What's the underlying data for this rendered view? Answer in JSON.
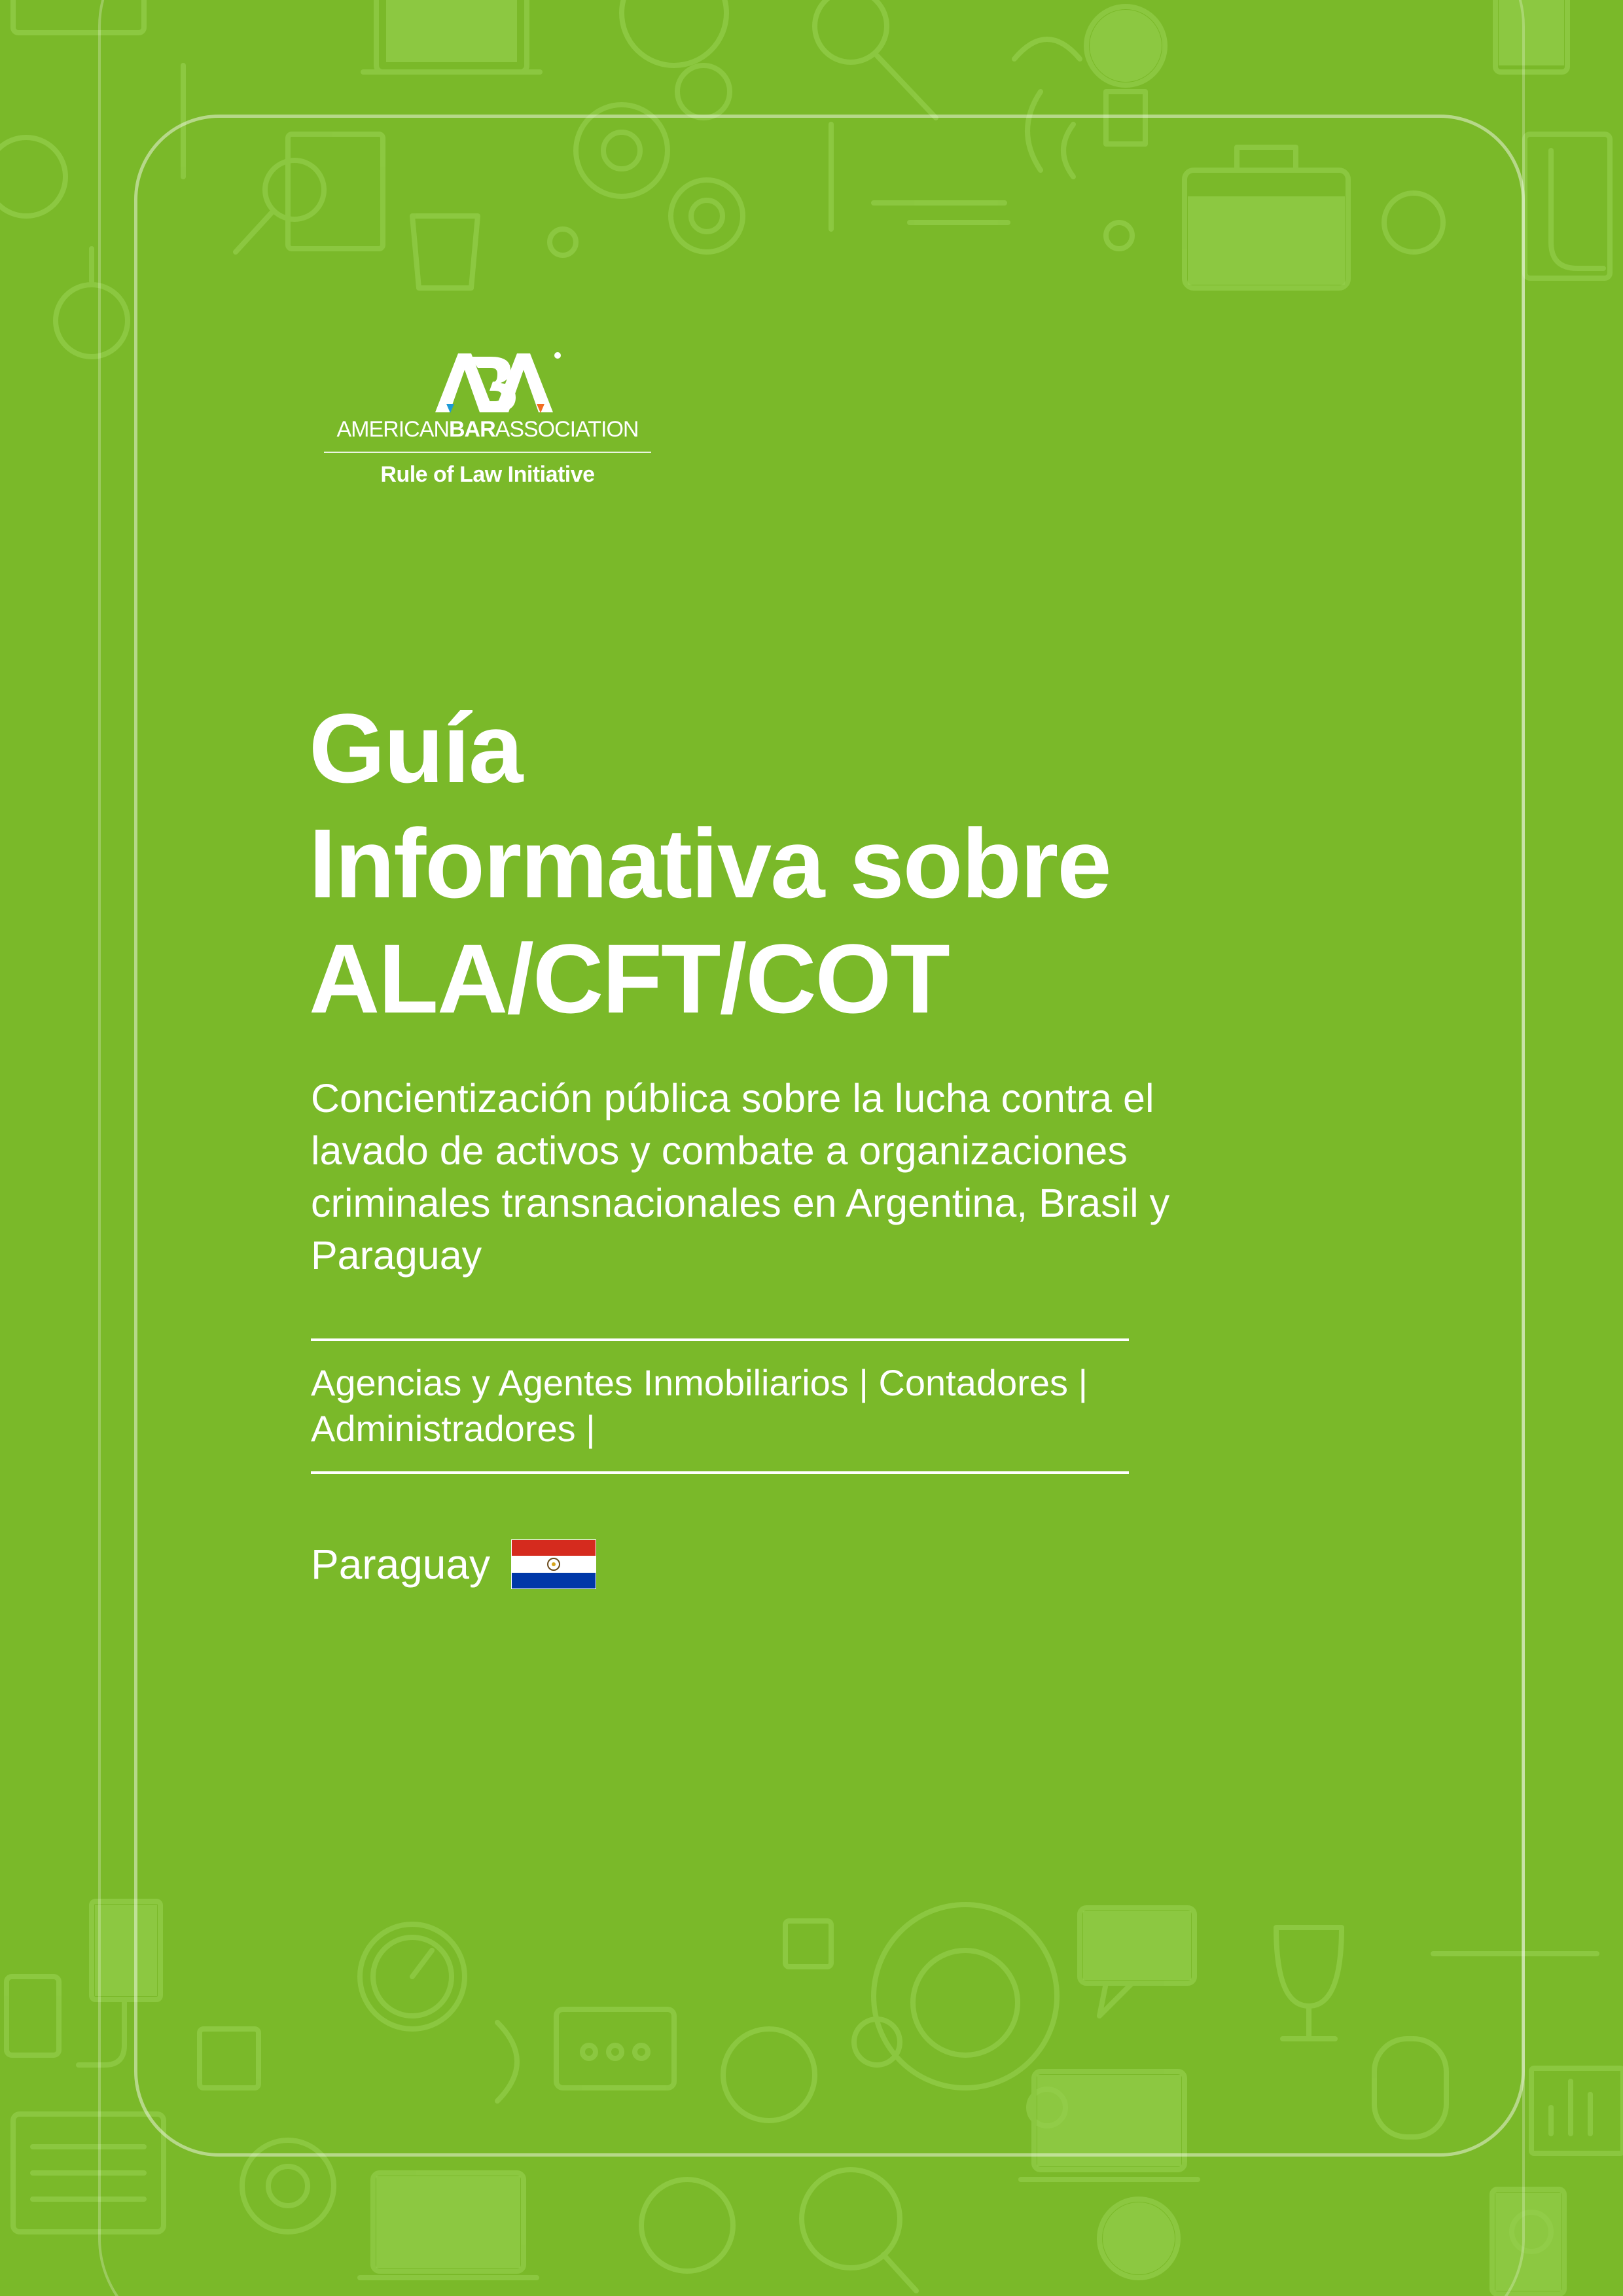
{
  "logo": {
    "letters": "ABA",
    "name_part1": "AMERICAN",
    "name_part2": "BAR",
    "name_part3": "ASSOCIATION",
    "subtitle": "Rule of Law Initiative"
  },
  "title_lines": [
    "Guía",
    "Informativa sobre",
    "ALA/CFT/COT"
  ],
  "subtitle": "Concientización pública sobre la lucha contra el lavado de activos y combate a organizaciones criminales transnacionales en Argentina, Brasil y Paraguay",
  "audience": "Agencias y Agentes Inmobiliarios | Contadores | Administradores |",
  "country": "Paraguay",
  "flag_icon": "paraguay-flag-icon",
  "colors": {
    "background": "#7ab929",
    "text": "#ffffff",
    "flag_red": "#d52b1e",
    "flag_white": "#ffffff",
    "flag_blue": "#0038a8"
  }
}
